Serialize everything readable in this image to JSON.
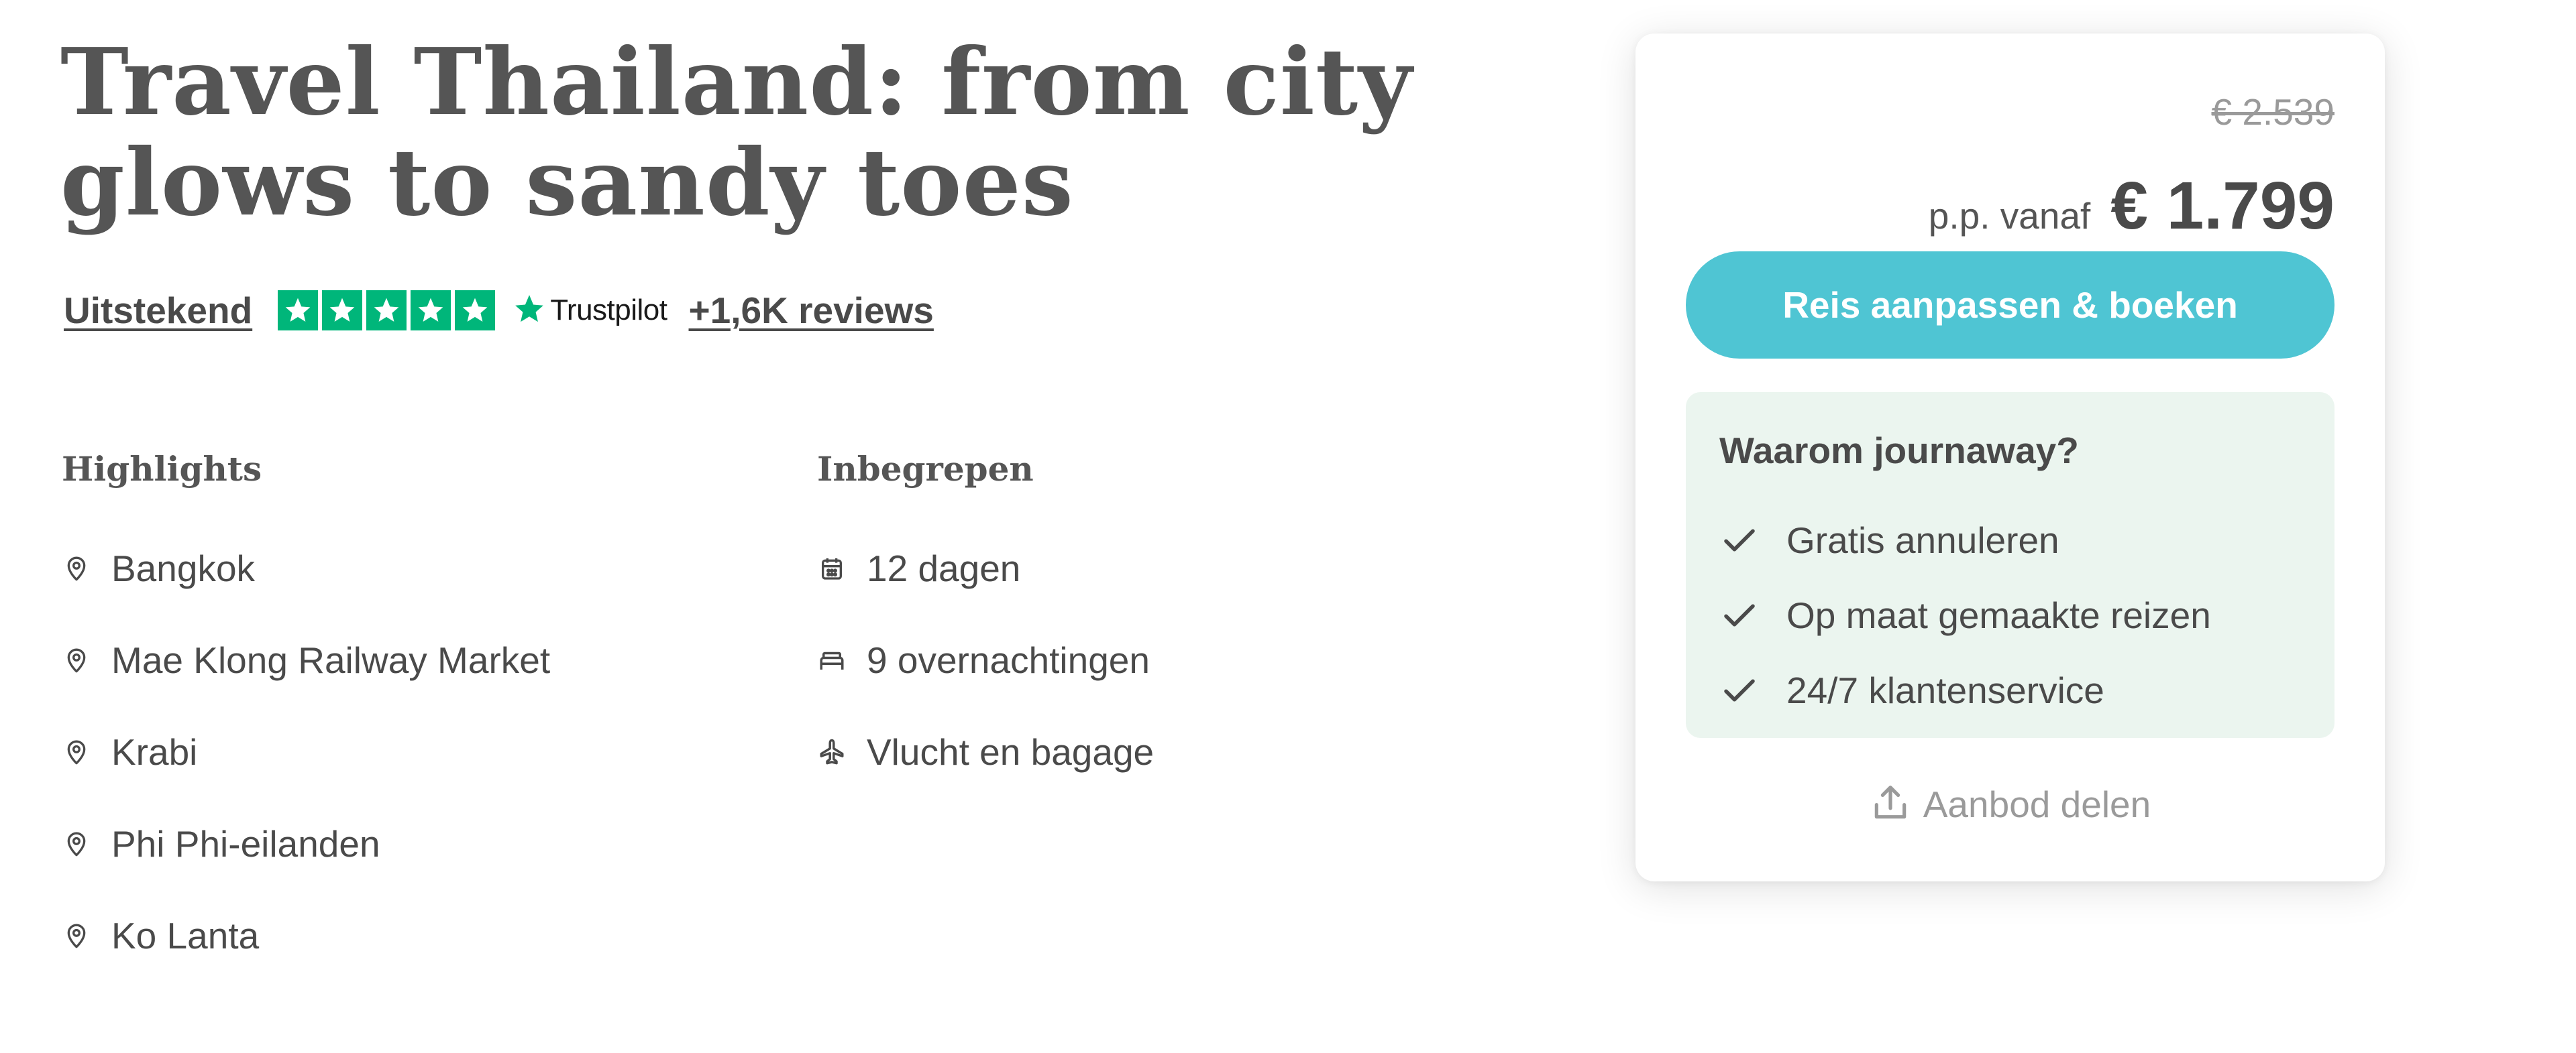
{
  "title": "Travel Thailand: from city glows to sandy toes",
  "rating": {
    "word": "Uitstekend",
    "stars": 5,
    "provider": "Trustpilot",
    "reviews_label": "+1,6K reviews",
    "star_color": "#00b67a"
  },
  "highlights": {
    "heading": "Highlights",
    "items": [
      {
        "icon": "map-pin-icon",
        "label": "Bangkok"
      },
      {
        "icon": "map-pin-icon",
        "label": "Mae Klong Railway Market"
      },
      {
        "icon": "map-pin-icon",
        "label": "Krabi"
      },
      {
        "icon": "map-pin-icon",
        "label": "Phi Phi-eilanden"
      },
      {
        "icon": "map-pin-icon",
        "label": "Ko Lanta"
      }
    ]
  },
  "included": {
    "heading": "Inbegrepen",
    "items": [
      {
        "icon": "calendar-icon",
        "label": "12 dagen"
      },
      {
        "icon": "bed-icon",
        "label": "9 overnachtingen"
      },
      {
        "icon": "plane-icon",
        "label": "Vlucht en bagage"
      }
    ]
  },
  "booking": {
    "old_price": "€ 2.539",
    "price_prefix": "p.p. vanaf",
    "price": "€ 1.799",
    "cta_label": "Reis aanpassen & boeken",
    "cta_color": "#4fc5d3",
    "why": {
      "title": "Waarom journaway?",
      "items": [
        "Gratis annuleren",
        "Op maat gemaakte reizen",
        "24/7 klantenservice"
      ],
      "background": "#ebf5ef"
    },
    "share_label": "Aanbod delen"
  }
}
